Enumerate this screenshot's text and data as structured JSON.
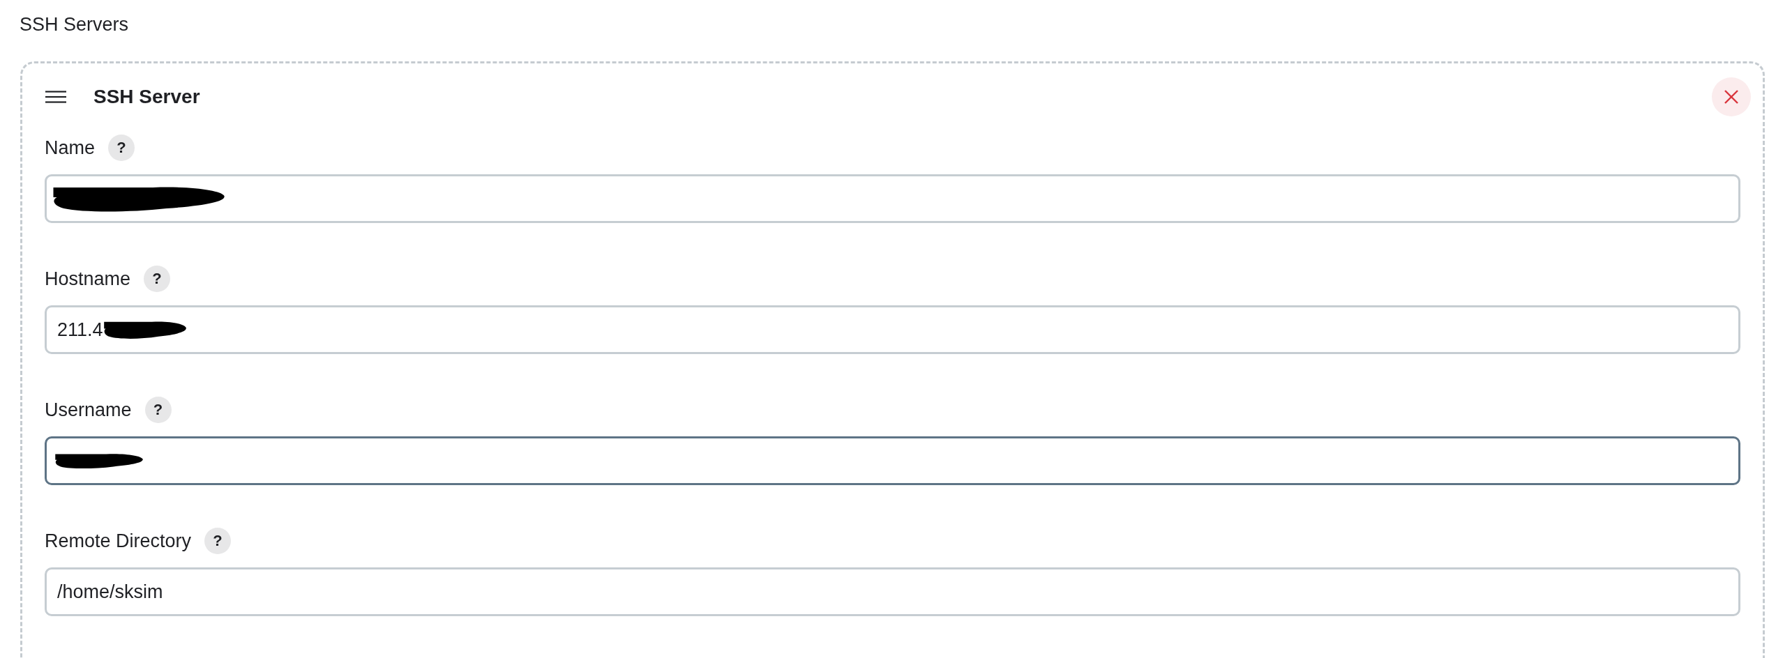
{
  "section_title": "SSH Servers",
  "server": {
    "title": "SSH Server",
    "fields": [
      {
        "label": "Name",
        "help": "?",
        "redacted": true,
        "focused": false
      },
      {
        "label": "Hostname",
        "help": "?",
        "value": "211.4",
        "redacted": true,
        "focused": false
      },
      {
        "label": "Username",
        "help": "?",
        "redacted": true,
        "focused": true
      },
      {
        "label": "Remote Directory",
        "help": "?",
        "value": "/home/sksim",
        "redacted": false,
        "focused": false
      }
    ]
  }
}
